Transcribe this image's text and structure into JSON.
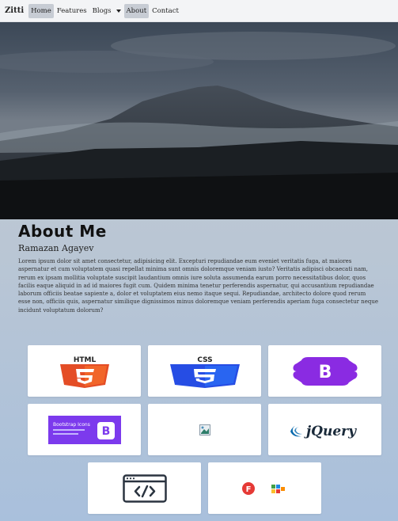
{
  "navbar": {
    "brand": "Zitti",
    "items": [
      {
        "label": "Home",
        "active": true
      },
      {
        "label": "Features",
        "active": false
      },
      {
        "label": "Blogs",
        "active": false,
        "dropdown": true
      },
      {
        "label": "About",
        "active": true
      },
      {
        "label": "Contact",
        "active": false
      }
    ]
  },
  "about": {
    "title": "About Me",
    "name": "Ramazan Agayev",
    "text": "Lorem ipsum dolor sit amet consectetur, adipisicing elit. Excepturi repudiandae eum eveniet veritatis fuga, at maiores aspernatur et cum voluptatem quasi repellat minima sunt omnis doloremque veniam iusto? Veritatis adipisci obcaecati nam, rerum ex ipsam mollitia voluptate suscipit laudantium omnis iure soluta assumenda earum porro necessitatibus dolor, quos facilis eaque aliquid in ad id maiores fugit cum. Quidem minima tenetur perferendis aspernatur, qui accusantium repudiandae laborum officiis beatae sapiente a, dolor et voluptatem eius nemo itaque sequi. Repudiandae, architecto dolore quod rerum esse non, officiis quis, aspernatur similique dignissimos minus doloremque veniam perferendis aperiam fuga consectetur neque incidunt voluptatum dolorum?"
  },
  "skills": {
    "html": {
      "label": "HTML",
      "icon": "html5-logo-icon",
      "color": "#e44d26"
    },
    "css": {
      "label": "CSS",
      "icon": "css3-logo-icon",
      "color": "#264de4"
    },
    "bootstrap": {
      "label": "B",
      "icon": "bootstrap-logo-icon",
      "color": "#7952b3"
    },
    "bootstrap_icons": {
      "label": "Bootstrap Icons",
      "icon": "bootstrap-icons-logo-icon",
      "color": "#7952b3"
    },
    "broken_image": {
      "icon": "broken-image-icon"
    },
    "jquery": {
      "label": "jQuery",
      "icon": "jquery-logo-icon",
      "color": "#0769ad"
    },
    "code_window": {
      "icon": "code-window-icon"
    },
    "font_apps": {
      "badge": "F",
      "icon": "font-apps-icon",
      "color": "#e53935"
    }
  }
}
